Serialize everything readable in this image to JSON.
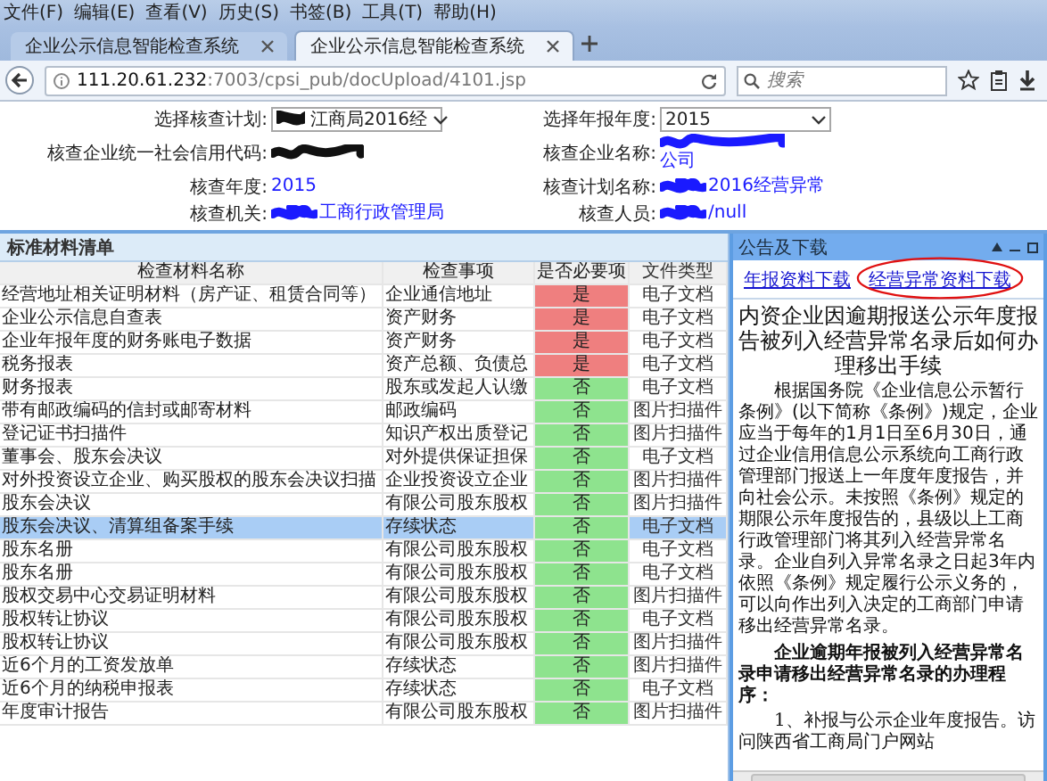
{
  "browser": {
    "menu": [
      "文件(F)",
      "编辑(E)",
      "查看(V)",
      "历史(S)",
      "书签(B)",
      "工具(T)",
      "帮助(H)"
    ],
    "tabs": [
      {
        "title": "企业公示信息智能检查系统",
        "selected": false
      },
      {
        "title": "企业公示信息智能检查系统",
        "selected": true
      }
    ],
    "address": {
      "host": "111.20.61.232",
      "path": ":7003/cpsi_pub/docUpload/4101.jsp"
    },
    "search": {
      "placeholder": "搜索"
    }
  },
  "form": {
    "fields": [
      {
        "label": "选择核查计划:",
        "kind": "select",
        "value": "江商局2016经",
        "redacted": true
      },
      {
        "label": "选择年报年度:",
        "kind": "select",
        "value": "2015",
        "redacted": false
      },
      {
        "label": "核查企业统一社会信用代码:",
        "kind": "text",
        "redacted": true
      },
      {
        "label": "核查企业名称:",
        "kind": "stacked",
        "value": "公司",
        "redacted": true
      },
      {
        "label": "核查年度:",
        "kind": "text",
        "value": "2015",
        "redacted": false
      },
      {
        "label": "核查计划名称:",
        "kind": "text",
        "value": "2016经营异常",
        "redacted": true
      },
      {
        "label": "核查机关:",
        "kind": "text",
        "value": "工商行政管理局",
        "redacted": true
      },
      {
        "label": "核查人员:",
        "kind": "text",
        "value": "/null",
        "redacted": true
      }
    ]
  },
  "materials": {
    "title": "标准材料清单",
    "columns": [
      "检查材料名称",
      "检查事项",
      "是否必要项",
      "文件类型"
    ],
    "rows": [
      {
        "name": "经营地址相关证明材料（房产证、租赁合同等）",
        "item": "企业通信地址",
        "required": true,
        "required_text": "是",
        "type": "电子文档",
        "selected": false
      },
      {
        "name": "企业公示信息自查表",
        "item": "资产财务",
        "required": true,
        "required_text": "是",
        "type": "电子文档",
        "selected": false
      },
      {
        "name": "企业年报年度的财务账电子数据",
        "item": "资产财务",
        "required": true,
        "required_text": "是",
        "type": "电子文档",
        "selected": false
      },
      {
        "name": "税务报表",
        "item": "资产总额、负债总",
        "required": true,
        "required_text": "是",
        "type": "电子文档",
        "selected": false
      },
      {
        "name": "财务报表",
        "item": "股东或发起人认缴",
        "required": false,
        "required_text": "否",
        "type": "电子文档",
        "selected": false
      },
      {
        "name": "带有邮政编码的信封或邮寄材料",
        "item": "邮政编码",
        "required": false,
        "required_text": "否",
        "type": "图片扫描件",
        "selected": false
      },
      {
        "name": "登记证书扫描件",
        "item": "知识产权出质登记",
        "required": false,
        "required_text": "否",
        "type": "图片扫描件",
        "selected": false
      },
      {
        "name": "董事会、股东会决议",
        "item": "对外提供保证担保",
        "required": false,
        "required_text": "否",
        "type": "电子文档",
        "selected": false
      },
      {
        "name": "对外投资设立企业、购买股权的股东会决议扫描",
        "item": "企业投资设立企业",
        "required": false,
        "required_text": "否",
        "type": "图片扫描件",
        "selected": false
      },
      {
        "name": "股东会决议",
        "item": "有限公司股东股权",
        "required": false,
        "required_text": "否",
        "type": "图片扫描件",
        "selected": false
      },
      {
        "name": "股东会决议、清算组备案手续",
        "item": "存续状态",
        "required": false,
        "required_text": "否",
        "type": "电子文档",
        "selected": true
      },
      {
        "name": "股东名册",
        "item": "有限公司股东股权",
        "required": false,
        "required_text": "否",
        "type": "电子文档",
        "selected": false
      },
      {
        "name": "股东名册",
        "item": "有限公司股东股权",
        "required": false,
        "required_text": "否",
        "type": "电子文档",
        "selected": false
      },
      {
        "name": "股权交易中心交易证明材料",
        "item": "有限公司股东股权",
        "required": false,
        "required_text": "否",
        "type": "图片扫描件",
        "selected": false
      },
      {
        "name": "股权转让协议",
        "item": "有限公司股东股权",
        "required": false,
        "required_text": "否",
        "type": "电子文档",
        "selected": false
      },
      {
        "name": "股权转让协议",
        "item": "有限公司股东股权",
        "required": false,
        "required_text": "否",
        "type": "图片扫描件",
        "selected": false
      },
      {
        "name": "近6个月的工资发放单",
        "item": "存续状态",
        "required": false,
        "required_text": "否",
        "type": "图片扫描件",
        "selected": false
      },
      {
        "name": "近6个月的纳税申报表",
        "item": "存续状态",
        "required": false,
        "required_text": "否",
        "type": "电子文档",
        "selected": false
      },
      {
        "name": "年度审计报告",
        "item": "有限公司股东股权",
        "required": false,
        "required_text": "否",
        "type": "图片扫描件",
        "selected": false
      }
    ]
  },
  "notice": {
    "title": "公告及下载",
    "links": [
      {
        "label": "年报资料下载",
        "circled": false
      },
      {
        "label": "经营异常资料下载",
        "circled": true
      }
    ],
    "article": {
      "title": "内资企业因逾期报送公示年度报告被列入经营异常名录后如何办理移出手续",
      "paragraph": "根据国务院《企业信息公示暂行条例》(以下简称《条例》)规定，企业应当于每年的1月1日至6月30日，通过企业信用信息公示系统向工商行政管理部门报送上一年度年度报告，并向社会公示。未按照《条例》规定的期限公示年度报告的，县级以上工商行政管理部门将其列入经营异常名录。企业自列入异常名录之日起3年内依照《条例》规定履行公示义务的，可以向作出列入决定的工商部门申请移出经营异常名录。",
      "heading": "企业逾期年报被列入经营异常名录申请移出经营异常名录的办理程序：",
      "step": "1、补报与公示企业年度报告。访问陕西省工商局门户网站"
    }
  }
}
